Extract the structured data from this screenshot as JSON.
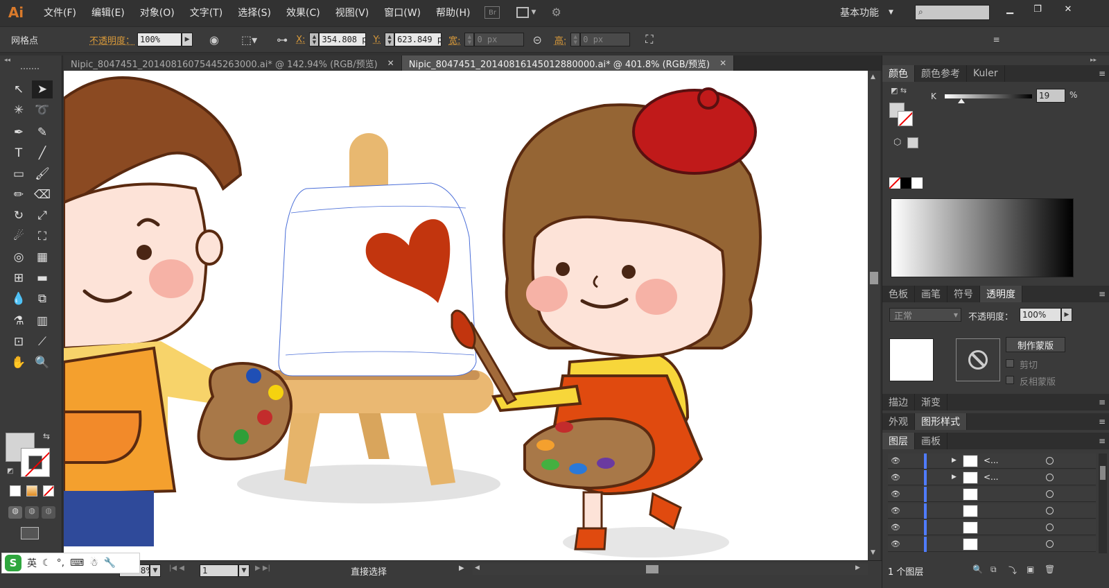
{
  "app": {
    "logo": "Ai",
    "bridge_label": "Br",
    "workspace": "基本功能",
    "menu": [
      "文件(F)",
      "编辑(E)",
      "对象(O)",
      "文字(T)",
      "选择(S)",
      "效果(C)",
      "视图(V)",
      "窗口(W)",
      "帮助(H)"
    ]
  },
  "control": {
    "selection_type": "网格点",
    "opacity_label": "不透明度：",
    "opacity_value": "100%",
    "x_label": "X:",
    "x_value": "354.808 p",
    "y_label": "Y:",
    "y_value": "623.849 p",
    "width_label": "宽:",
    "width_value": "0 px",
    "height_label": "高:",
    "height_value": "0 px"
  },
  "tabs": [
    {
      "label": "Nipic_8047451_20140816075445263000.ai* @ 142.94% (RGB/预览)",
      "active": false
    },
    {
      "label": "Nipic_8047451_20140816145012880000.ai* @ 401.8% (RGB/预览)",
      "active": true
    }
  ],
  "status": {
    "zoom": "401.8%",
    "artboard_number": "1",
    "tool_name": "直接选择"
  },
  "ime": {
    "logo": "S",
    "lang": "英"
  },
  "panels": {
    "color_tabs": [
      "颜色",
      "颜色参考",
      "Kuler"
    ],
    "k_label": "K",
    "k_value": "19",
    "k_unit": "%",
    "k_fraction": 0.19,
    "swatch_tabs": [
      "色板",
      "画笔",
      "符号",
      "透明度"
    ],
    "blend_mode": "正常",
    "opacity_label": "不透明度：",
    "opacity_value": "100%",
    "make_mask": "制作蒙版",
    "clip_label": "剪切",
    "invert_label": "反相蒙版",
    "stroke_tabs": [
      "描边",
      "渐变"
    ],
    "appearance_tabs": [
      "外观",
      "图形样式"
    ],
    "layer_tabs": [
      "图层",
      "画板"
    ],
    "layers": [
      {
        "name": "<...",
        "expandable": true
      },
      {
        "name": "<...",
        "expandable": true
      },
      {
        "name": "",
        "expandable": false
      },
      {
        "name": "",
        "expandable": false
      },
      {
        "name": "",
        "expandable": false
      },
      {
        "name": "",
        "expandable": false
      }
    ],
    "layers_count": "1 个图层"
  },
  "colors": {
    "accent_orange": "#d99a3a",
    "layer_blue": "#4f7cff",
    "selection_blue": "#4a6ed8"
  }
}
